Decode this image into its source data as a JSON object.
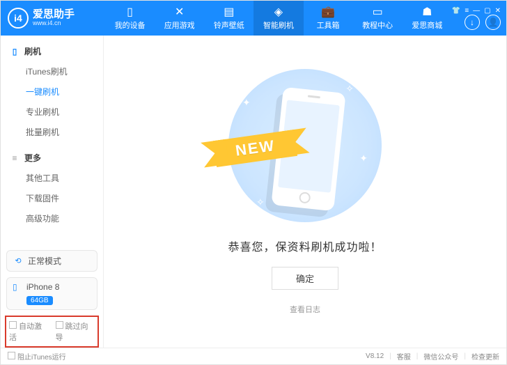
{
  "brand": {
    "initials": "i4",
    "name": "爱思助手",
    "site": "www.i4.cn"
  },
  "topnav": [
    {
      "label": "我的设备"
    },
    {
      "label": "应用游戏"
    },
    {
      "label": "铃声壁纸"
    },
    {
      "label": "智能刷机"
    },
    {
      "label": "工具箱"
    },
    {
      "label": "教程中心"
    },
    {
      "label": "爱思商城"
    }
  ],
  "sidebar": {
    "group1": "刷机",
    "items1": [
      "iTunes刷机",
      "一键刷机",
      "专业刷机",
      "批量刷机"
    ],
    "group2": "更多",
    "items2": [
      "其他工具",
      "下载固件",
      "高级功能"
    ]
  },
  "status": {
    "mode": "正常模式"
  },
  "device": {
    "name": "iPhone 8",
    "storage": "64GB"
  },
  "checks": {
    "auto_activate": "自动激活",
    "skip_wizard": "跳过向导"
  },
  "main": {
    "ribbon": "NEW",
    "success": "恭喜您，保资料刷机成功啦！",
    "confirm": "确定",
    "log": "查看日志"
  },
  "footer": {
    "block_itunes": "阻止iTunes运行",
    "version": "V8.12",
    "support": "客服",
    "wechat": "微信公众号",
    "update": "检查更新"
  }
}
